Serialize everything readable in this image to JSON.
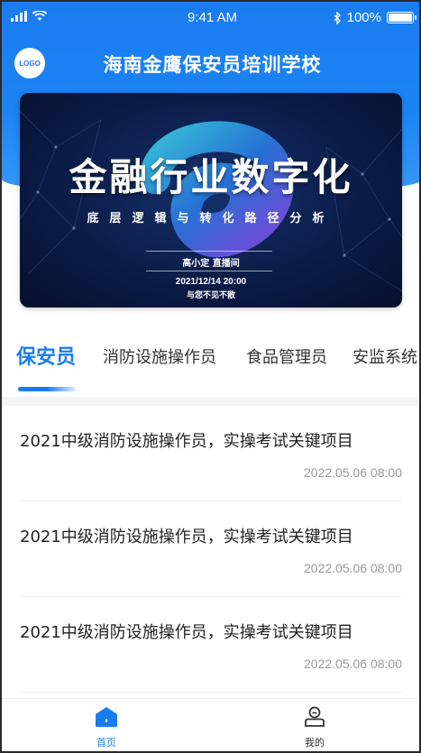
{
  "status_bar": {
    "time": "9:41 AM",
    "battery": "100%"
  },
  "header": {
    "logo_text": "LOGO",
    "title": "海南金鹰保安员培训学校"
  },
  "banner": {
    "title": "金融行业数字化",
    "subtitle": "底层逻辑与转化路径分析",
    "host": "高小定 直播间",
    "datetime": "2021/12/14  20:00",
    "note": "与您不见不散"
  },
  "tabs": [
    {
      "label": "保安员",
      "active": true
    },
    {
      "label": "消防设施操作员",
      "active": false
    },
    {
      "label": "食品管理员",
      "active": false
    },
    {
      "label": "安监系统",
      "active": false
    }
  ],
  "news": [
    {
      "title": "2021中级消防设施操作员，实操考试关键项目",
      "date": "2022.05.06 08:00"
    },
    {
      "title": "2021中级消防设施操作员，实操考试关键项目",
      "date": "2022.05.06 08:00"
    },
    {
      "title": "2021中级消防设施操作员，实操考试关键项目",
      "date": "2022.05.06 08:00"
    }
  ],
  "tabbar": [
    {
      "label": "首页",
      "icon": "home-icon",
      "active": true
    },
    {
      "label": "我的",
      "icon": "user-icon",
      "active": false
    }
  ],
  "colors": {
    "primary": "#1b7cf0",
    "text": "#222222",
    "muted": "#999999"
  }
}
